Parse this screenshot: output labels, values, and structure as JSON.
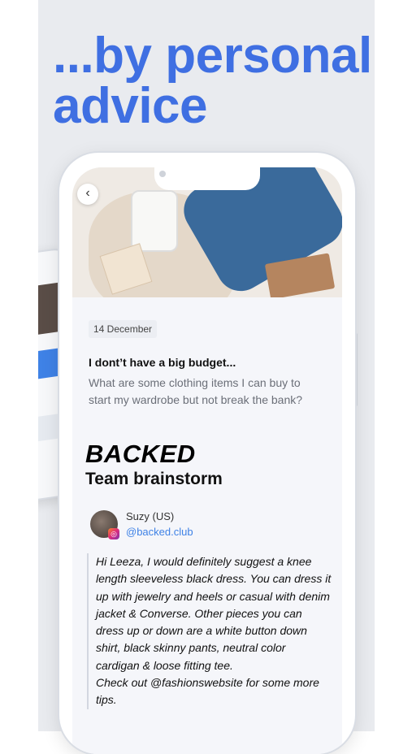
{
  "headline": "...by personal advice",
  "post": {
    "date": "14 December",
    "question_title": "I dont’t have a big budget...",
    "question_body": "What are some clothing items I can buy to start my wardrobe but not break the bank?"
  },
  "brand": "BACKED",
  "subtitle": "Team brainstorm",
  "author": {
    "name": "Suzy (US)",
    "handle": "@backed.club"
  },
  "answer": "Hi Leeza, I would definitely suggest a knee length sleeveless black dress. You can dress it up with jewelry and heels or casual with denim jacket & Converse. Other pieces you can dress up or down are a white button down shirt, black skinny pants, neutral color cardigan & loose fitting tee.",
  "answer_footer": "Check out @fashionswebsite for some more tips.",
  "colors": {
    "accent": "#3f6fe2",
    "link": "#3f82e6",
    "panel_bg": "#e9ebef"
  },
  "icons": [
    "back-chevron-icon",
    "instagram-icon"
  ]
}
